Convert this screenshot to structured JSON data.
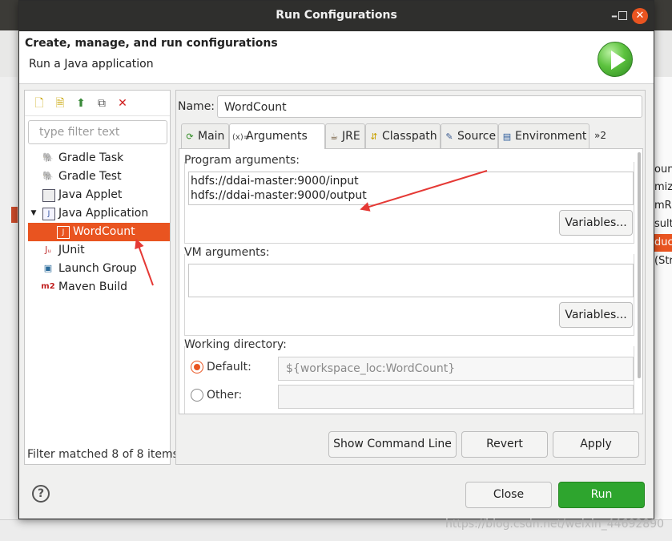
{
  "window": {
    "title": "Run Configurations"
  },
  "header": {
    "title": "Create, manage, and run configurations",
    "subtitle": "Run a Java application"
  },
  "left": {
    "filter_placeholder": "type filter text",
    "tree": [
      {
        "label": "Gradle Task",
        "icon": "gradle-icon",
        "level": 1
      },
      {
        "label": "Gradle Test",
        "icon": "gradle-icon",
        "level": 1
      },
      {
        "label": "Java Applet",
        "icon": "java-applet-icon",
        "level": 1
      },
      {
        "label": "Java Application",
        "icon": "java-application-icon",
        "level": 1,
        "expanded": true
      },
      {
        "label": "WordCount",
        "icon": "java-config-icon",
        "level": 2,
        "selected": true
      },
      {
        "label": "JUnit",
        "icon": "junit-icon",
        "level": 1
      },
      {
        "label": "Launch Group",
        "icon": "launch-group-icon",
        "level": 1
      },
      {
        "label": "Maven Build",
        "icon": "maven-icon",
        "level": 1
      }
    ],
    "status": "Filter matched 8 of 8 items"
  },
  "config": {
    "name_label": "Name:",
    "name_value": "WordCount",
    "tabs": [
      {
        "label": "Main",
        "icon": "main-tab-icon"
      },
      {
        "label": "Arguments",
        "icon": "arguments-tab-icon",
        "active": true
      },
      {
        "label": "JRE",
        "icon": "jre-tab-icon"
      },
      {
        "label": "Classpath",
        "icon": "classpath-tab-icon"
      },
      {
        "label": "Source",
        "icon": "source-tab-icon"
      },
      {
        "label": "Environment",
        "icon": "environment-tab-icon"
      },
      {
        "label": "»2",
        "icon": "overflow-tabs-icon"
      }
    ],
    "program_arguments_label": "Program arguments:",
    "program_arguments": [
      "hdfs://ddai-master:9000/input",
      "hdfs://ddai-master:9000/output"
    ],
    "variables_label": "Variables...",
    "vm_arguments_label": "VM arguments:",
    "vm_arguments": "",
    "working_directory_label": "Working directory:",
    "default_label": "Default:",
    "default_value": "${workspace_loc:WordCount}",
    "other_label": "Other:",
    "other_value": ""
  },
  "actions": {
    "show_command_line": "Show Command Line",
    "revert": "Revert",
    "apply": "Apply",
    "close": "Close",
    "run": "Run"
  },
  "background": {
    "right_texts": [
      "ount",
      "mize",
      "mR",
      "sult",
      "duc",
      "(Str"
    ]
  },
  "watermark": "https://blog.csdn.net/weixin_44692890",
  "colors": {
    "accent": "#e95420",
    "run_button": "#2ea52e",
    "annotation_arrow": "#e53935"
  }
}
